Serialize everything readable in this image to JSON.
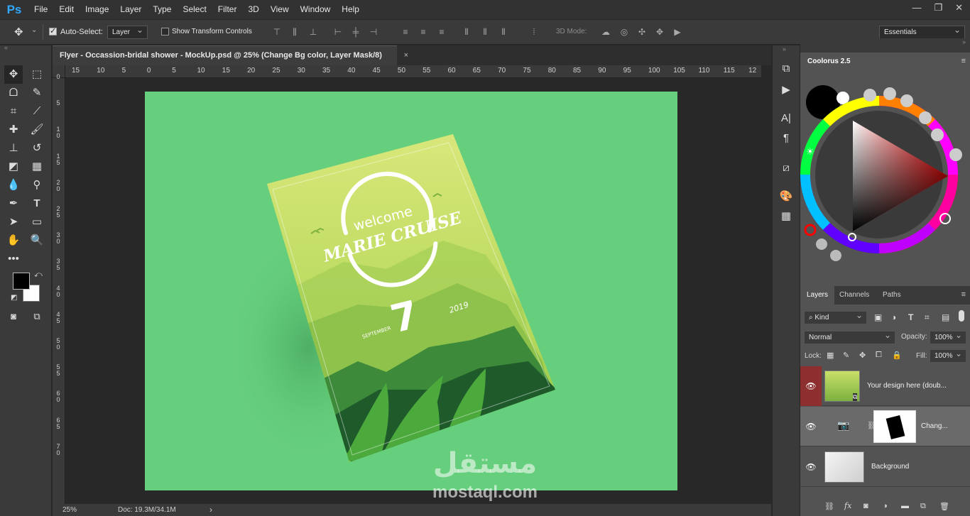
{
  "app": {
    "logo": "Ps"
  },
  "menu": [
    "File",
    "Edit",
    "Image",
    "Layer",
    "Type",
    "Select",
    "Filter",
    "3D",
    "View",
    "Window",
    "Help"
  ],
  "window_controls": [
    "—",
    "❐",
    "✕"
  ],
  "options": {
    "auto_select_label": "Auto-Select:",
    "auto_select_value": "Layer",
    "transform_label": "Show Transform Controls",
    "mode_3d": "3D Mode:",
    "workspace": "Essentials"
  },
  "document": {
    "tab_title": "Flyer - Occassion-bridal shower  - MockUp.psd @ 25% (Change Bg color, Layer Mask/8)",
    "close": "×",
    "zoom": "25%",
    "doc_size": "Doc: 19.3M/34.1M",
    "arrow": "›"
  },
  "ruler": {
    "h_labels": [
      "15",
      "10",
      "5",
      "0",
      "5",
      "10",
      "15",
      "20",
      "25",
      "30",
      "35",
      "40",
      "45",
      "50",
      "55",
      "60",
      "65",
      "70",
      "75",
      "80",
      "85",
      "90",
      "95",
      "100",
      "105",
      "110",
      "115",
      "12"
    ],
    "v_labels": [
      "0",
      "5",
      "1\n0",
      "1\n5",
      "2\n0",
      "2\n5",
      "3\n0",
      "3\n5",
      "4\n0",
      "4\n5",
      "5\n0",
      "5\n5",
      "6\n0",
      "6\n5",
      "7\n0"
    ]
  },
  "flyer": {
    "welcome": "welcome",
    "name": "MARIE CRUISE",
    "day": "7",
    "year": "2019",
    "month": "SEPTEMBER"
  },
  "coolorus": {
    "title": "Coolorus 2.5"
  },
  "layers_panel": {
    "tabs": [
      "Layers",
      "Channels",
      "Paths"
    ],
    "kind": "Kind",
    "blend_mode": "Normal",
    "opacity_label": "Opacity:",
    "opacity_value": "100%",
    "lock_label": "Lock:",
    "fill_label": "Fill:",
    "fill_value": "100%",
    "layers": [
      {
        "name": "Your design here (doub..."
      },
      {
        "name": "Chang..."
      },
      {
        "name": "Background"
      }
    ]
  },
  "watermark": {
    "arabic": "مستقل",
    "latin": "mostaql.com"
  },
  "colors": {
    "accent_green": "#66cf7d",
    "layer_eye_red": "#8e2f2f",
    "ps_blue": "#31a8ff"
  }
}
